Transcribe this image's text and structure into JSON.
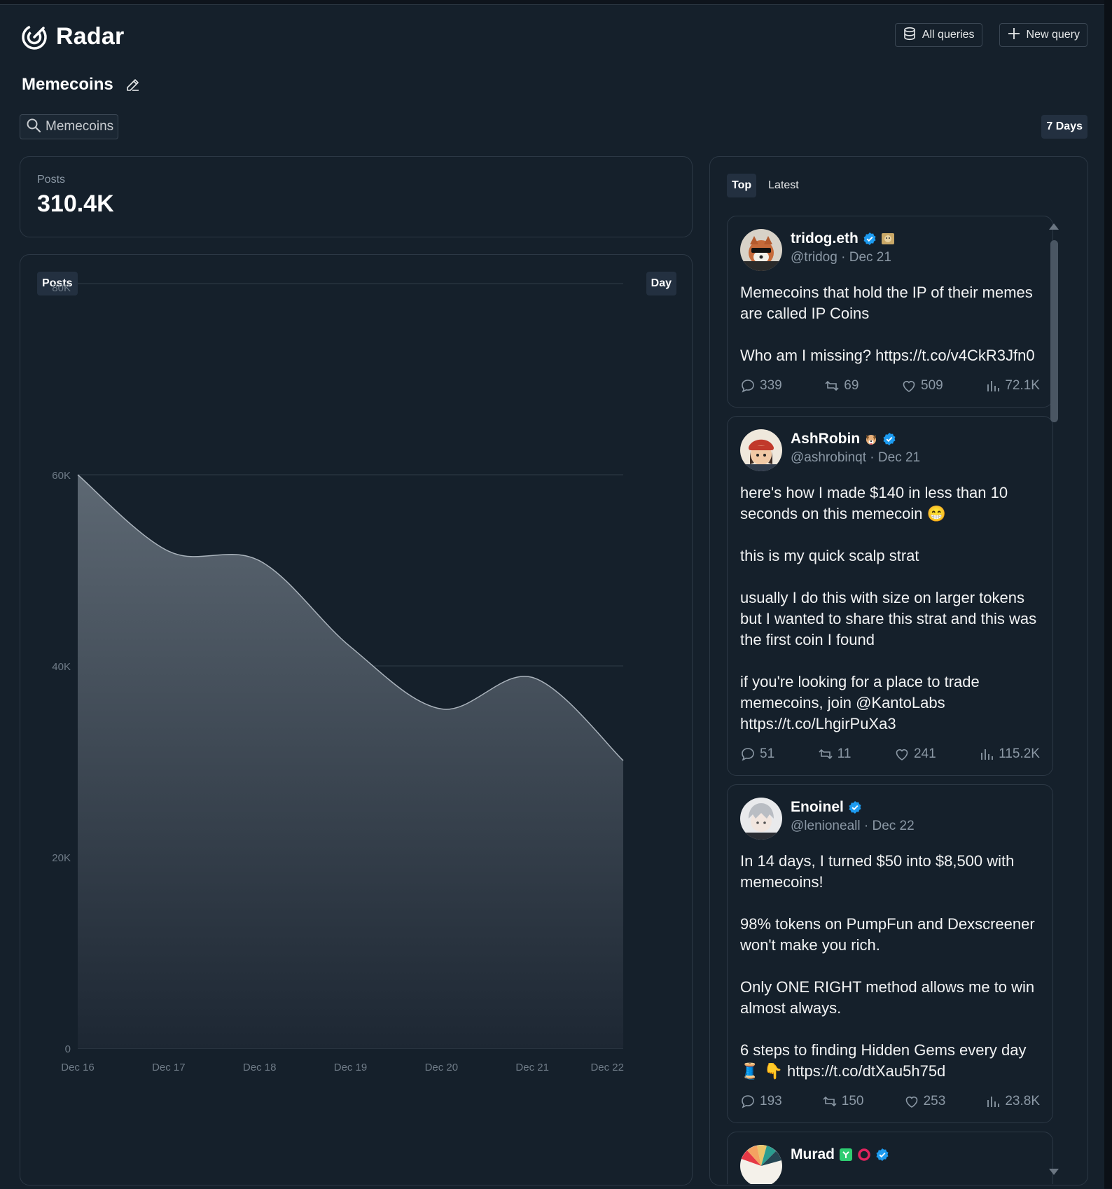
{
  "app": {
    "name": "Radar"
  },
  "header": {
    "all_queries": "All queries",
    "new_query": "New query"
  },
  "query": {
    "title": "Memecoins",
    "search_term": "Memecoins",
    "range": "7 Days"
  },
  "stats": {
    "posts_label": "Posts",
    "posts_value": "310.4K"
  },
  "chart": {
    "metric_pill": "Posts",
    "interval_pill": "Day"
  },
  "chart_data": {
    "type": "area",
    "title": "",
    "xlabel": "",
    "ylabel": "",
    "x": [
      "Dec 16",
      "Dec 17",
      "Dec 18",
      "Dec 19",
      "Dec 20",
      "Dec 21",
      "Dec 22"
    ],
    "series": [
      {
        "values": [
          60000,
          52000,
          51000,
          42000,
          35500,
          38800,
          30100
        ]
      }
    ],
    "ylim": [
      0,
      80000
    ],
    "yticks": [
      0,
      20000,
      40000,
      60000,
      80000
    ],
    "ytick_labels": [
      "0",
      "20K",
      "40K",
      "60K",
      "80K"
    ],
    "grid": true,
    "fill_top_color": "#5d6873",
    "fill_bottom_color": "#1d2733",
    "line_color": "#a9b2bb"
  },
  "feed": {
    "tabs": [
      "Top",
      "Latest"
    ],
    "active_tab": "Top",
    "tweets": [
      {
        "name": "tridog.eth",
        "handle": "@tridog",
        "date": "Dec 21",
        "text": "Memecoins that hold the IP of their memes are called IP Coins\n\nWho am I missing? https://t.co/v4CkR3Jfn0",
        "replies": "339",
        "retweets": "69",
        "likes": "509",
        "views": "72.1K"
      },
      {
        "name": "AshRobin",
        "handle": "@ashrobinqt",
        "date": "Dec 21",
        "text": "here's how I made $140 in less than 10 seconds on this memecoin 😁\n\nthis is my quick scalp strat\n\nusually I do this with size on larger tokens but I wanted to share this strat and this was the first coin I found\n\nif you're looking for a place to trade memecoins, join @KantoLabs https://t.co/LhgirPuXa3",
        "replies": "51",
        "retweets": "11",
        "likes": "241",
        "views": "115.2K"
      },
      {
        "name": "Enoinel",
        "handle": "@lenioneall",
        "date": "Dec 22",
        "text": "In 14 days, I turned $50 into $8,500 with memecoins!\n\n98% tokens on PumpFun and Dexscreener won't make you rich.\n\nOnly ONE RIGHT method allows me to win almost always.\n\n6 steps to finding Hidden Gems every day 🧵 👇 https://t.co/dtXau5h75d",
        "replies": "193",
        "retweets": "150",
        "likes": "253",
        "views": "23.8K"
      },
      {
        "name": "Murad",
        "handle": "",
        "date": "",
        "text": "",
        "replies": "",
        "retweets": "",
        "likes": "",
        "views": ""
      }
    ]
  }
}
